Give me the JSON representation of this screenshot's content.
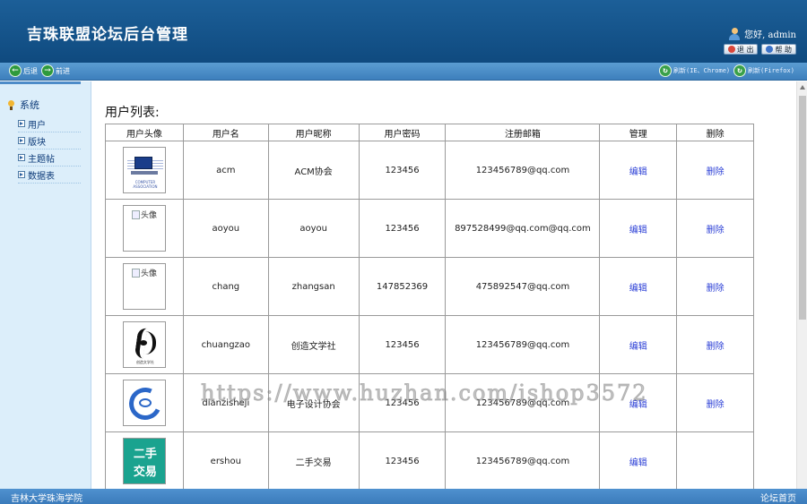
{
  "header": {
    "title": "吉珠联盟论坛后台管理",
    "greeting": "您好, admin",
    "logout_label": "退 出",
    "help_label": "帮 助"
  },
  "toolbar": {
    "back_label": "后退",
    "forward_label": "前进",
    "refresh_ie_label": "刷新(IE、Chrome)",
    "refresh_ff_label": "刷新(Firefox)"
  },
  "sidebar": {
    "group_label": "系统",
    "items": [
      {
        "label": "用户"
      },
      {
        "label": "版块"
      },
      {
        "label": "主题帖"
      },
      {
        "label": "数据表"
      }
    ]
  },
  "main": {
    "title": "用户列表:",
    "columns": [
      "用户头像",
      "用户名",
      "用户昵称",
      "用户密码",
      "注册邮箱",
      "管理",
      "删除"
    ],
    "rows": [
      {
        "avatar": "computer-association",
        "username": "acm",
        "nickname": "ACM协会",
        "password": "123456",
        "email": "123456789@qq.com",
        "manage": "编辑",
        "delete": "删除"
      },
      {
        "avatar": "broken",
        "avatar_alt": "头像",
        "username": "aoyou",
        "nickname": "aoyou",
        "password": "123456",
        "email": "897528499@qq.com@qq.com",
        "manage": "编辑",
        "delete": "删除"
      },
      {
        "avatar": "broken",
        "avatar_alt": "头像",
        "username": "chang",
        "nickname": "zhangsan",
        "password": "147852369",
        "email": "475892547@qq.com",
        "manage": "编辑",
        "delete": "删除"
      },
      {
        "avatar": "calligraphy",
        "username": "chuangzao",
        "nickname": "创造文学社",
        "password": "123456",
        "email": "123456789@qq.com",
        "manage": "编辑",
        "delete": "删除"
      },
      {
        "avatar": "design-association",
        "username": "dianzisheji",
        "nickname": "电子设计协会",
        "password": "123456",
        "email": "123456789@qq.com",
        "manage": "编辑",
        "delete": "删除"
      },
      {
        "avatar": "second-hand",
        "avatar_text_1": "二手",
        "avatar_text_2": "交易",
        "username": "ershou",
        "nickname": "二手交易",
        "password": "123456",
        "email": "123456789@qq.com",
        "manage": "编辑",
        "delete": ""
      }
    ]
  },
  "watermark": "https://www.huzhan.com/ishop3572",
  "footer": {
    "left": "吉林大学珠海学院",
    "right": "论坛首页"
  },
  "colors": {
    "header_bg": "#14548c",
    "toolbar_bg": "#4a8cc7",
    "sidebar_bg": "#dceefa",
    "link": "#2b3fd6"
  }
}
